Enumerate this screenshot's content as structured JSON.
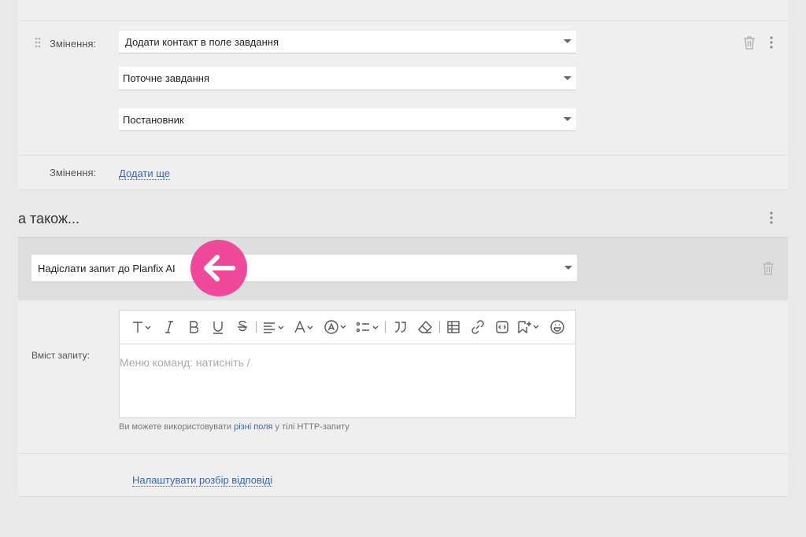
{
  "rule1": {
    "label": "Змінення:",
    "action_select": "Додати контакт в поле завдання",
    "target_select": "Поточне завдання",
    "field_select": "Постановник"
  },
  "rule_add": {
    "label": "Змінення:",
    "add_more": "Додати ще"
  },
  "also": {
    "heading": "а також..."
  },
  "action": {
    "select": "Надіслати запит до Planfix AI"
  },
  "request": {
    "label": "Вміст запиту:",
    "placeholder": "Меню команд: натисніть /",
    "hint_prefix": "Ви можете використовувати ",
    "hint_link": "різні поля",
    "hint_suffix": " у тілі HTTP-запиту"
  },
  "response": {
    "configure_link": "Налаштувати розбір відповіді"
  },
  "colors": {
    "accent_badge": "#f0489a",
    "link": "#3a66a8"
  }
}
